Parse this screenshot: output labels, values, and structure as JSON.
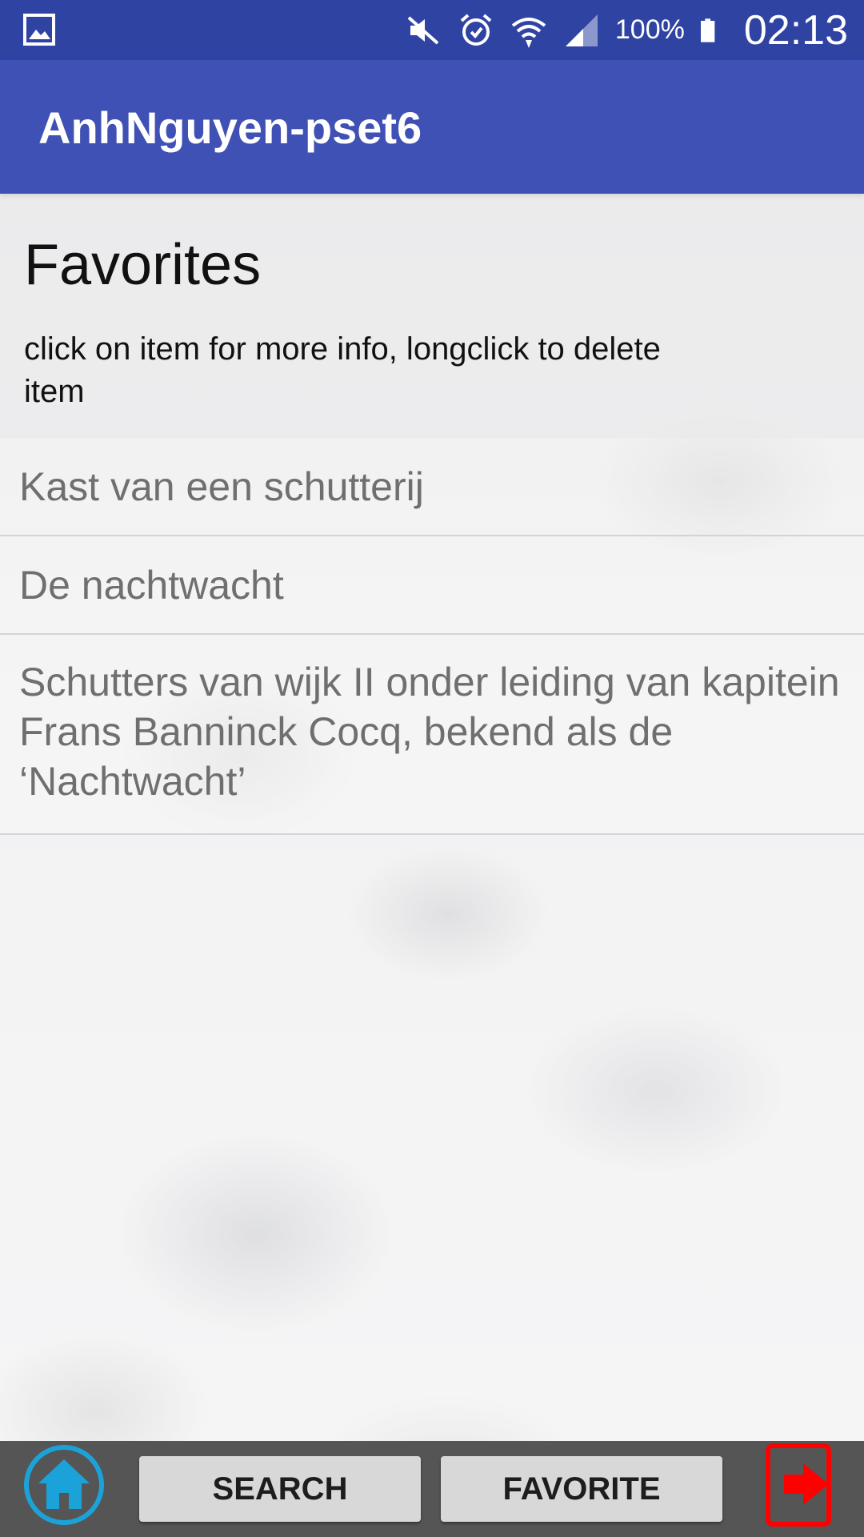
{
  "status_bar": {
    "battery_percent": "100%",
    "time": "02:13",
    "icons": [
      "gallery-icon",
      "mute-icon",
      "alarm-icon",
      "wifi-icon",
      "signal-icon",
      "battery-icon"
    ]
  },
  "app_bar": {
    "title": "AnhNguyen-pset6",
    "color": "#3f51b5"
  },
  "page": {
    "title": "Favorites",
    "instruction": "click on item for more info, longclick to delete item"
  },
  "favorites": [
    {
      "label": "Kast van een schutterij"
    },
    {
      "label": "De nachtwacht"
    },
    {
      "label": "Schutters van wijk II onder leiding van kapitein Frans Banninck Cocq, bekend als de ‘Nachtwacht’"
    }
  ],
  "bottom_bar": {
    "home_icon": "home-icon",
    "search_label": "SEARCH",
    "favorite_label": "FAVORITE",
    "logout_icon": "logout-icon",
    "accent_home": "#1ba3d9",
    "accent_logout": "#ff0000"
  }
}
